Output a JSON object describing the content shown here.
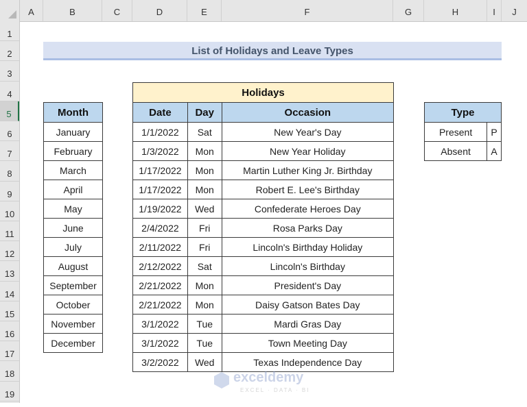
{
  "columns": [
    "A",
    "B",
    "C",
    "D",
    "E",
    "F",
    "G",
    "H",
    "I",
    "J"
  ],
  "rows": [
    "1",
    "2",
    "3",
    "4",
    "5",
    "6",
    "7",
    "8",
    "9",
    "10",
    "11",
    "12",
    "13",
    "14",
    "15",
    "16",
    "17",
    "18",
    "19"
  ],
  "selected_row": "5",
  "title": "List of Holidays and Leave Types",
  "months": {
    "header": "Month",
    "items": [
      "January",
      "February",
      "March",
      "April",
      "May",
      "June",
      "July",
      "August",
      "September",
      "October",
      "November",
      "December"
    ]
  },
  "holidays": {
    "banner": "Holidays",
    "headers": {
      "date": "Date",
      "day": "Day",
      "occasion": "Occasion"
    },
    "rows": [
      {
        "date": "1/1/2022",
        "day": "Sat",
        "occasion": "New Year's Day"
      },
      {
        "date": "1/3/2022",
        "day": "Mon",
        "occasion": "New Year Holiday"
      },
      {
        "date": "1/17/2022",
        "day": "Mon",
        "occasion": "Martin Luther King Jr. Birthday"
      },
      {
        "date": "1/17/2022",
        "day": "Mon",
        "occasion": "Robert E. Lee's Birthday"
      },
      {
        "date": "1/19/2022",
        "day": "Wed",
        "occasion": "Confederate Heroes Day"
      },
      {
        "date": "2/4/2022",
        "day": "Fri",
        "occasion": "Rosa Parks Day"
      },
      {
        "date": "2/11/2022",
        "day": "Fri",
        "occasion": "Lincoln's Birthday Holiday"
      },
      {
        "date": "2/12/2022",
        "day": "Sat",
        "occasion": "Lincoln's Birthday"
      },
      {
        "date": "2/21/2022",
        "day": "Mon",
        "occasion": "President's Day"
      },
      {
        "date": "2/21/2022",
        "day": "Mon",
        "occasion": "Daisy Gatson Bates Day"
      },
      {
        "date": "3/1/2022",
        "day": "Tue",
        "occasion": "Mardi Gras Day"
      },
      {
        "date": "3/1/2022",
        "day": "Tue",
        "occasion": "Town Meeting Day"
      },
      {
        "date": "3/2/2022",
        "day": "Wed",
        "occasion": "Texas Independence Day"
      }
    ]
  },
  "leave_types": {
    "header": "Type",
    "rows": [
      {
        "label": "Present",
        "code": "P"
      },
      {
        "label": "Absent",
        "code": "A"
      }
    ]
  },
  "watermark": {
    "name": "exceldemy",
    "tagline": "EXCEL · DATA · BI"
  },
  "colors": {
    "header_fill": "#bdd7ee",
    "banner_fill": "#fff2cc",
    "title_fill": "#d9e1f2",
    "title_text": "#44546a",
    "selection_accent": "#217346"
  }
}
